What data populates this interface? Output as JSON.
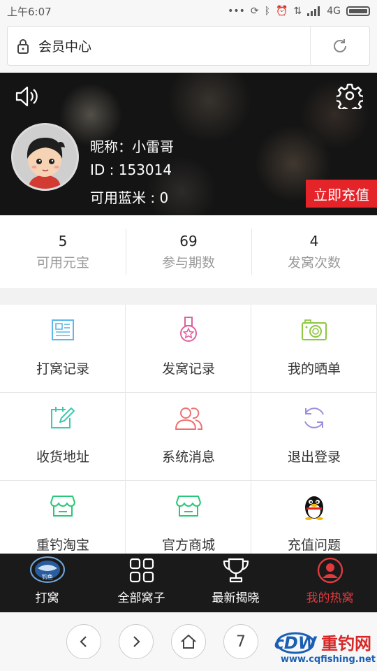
{
  "status_bar": {
    "time": "上午6:07",
    "network": "4G"
  },
  "url_bar": {
    "title": "会员中心"
  },
  "profile": {
    "nickname": "昵称：小雷哥",
    "id": "ID : 153014",
    "blue_rice": "可用蓝米 : 0",
    "recharge_label": "立即充值"
  },
  "stats": [
    {
      "value": "5",
      "label": "可用元宝"
    },
    {
      "value": "69",
      "label": "参与期数"
    },
    {
      "value": "4",
      "label": "发窝次数"
    }
  ],
  "menu": [
    {
      "label": "打窝记录",
      "icon": "document-icon",
      "color": "#5bb8e8"
    },
    {
      "label": "发窝记录",
      "icon": "medal-icon",
      "color": "#e060a0"
    },
    {
      "label": "我的晒单",
      "icon": "camera-icon",
      "color": "#8cc840"
    },
    {
      "label": "收货地址",
      "icon": "edit-calendar-icon",
      "color": "#3cc8b4"
    },
    {
      "label": "系统消息",
      "icon": "users-icon",
      "color": "#ee7070"
    },
    {
      "label": "退出登录",
      "icon": "refresh-icon",
      "color": "#9b8fe0"
    },
    {
      "label": "重钓淘宝",
      "icon": "shop-icon",
      "color": "#28c878"
    },
    {
      "label": "官方商城",
      "icon": "shop-icon",
      "color": "#28c878"
    },
    {
      "label": "充值问题",
      "icon": "qq-penguin-icon",
      "color": "#000000"
    }
  ],
  "bottom_nav": [
    {
      "label": "打窝",
      "icon": "logo-icon"
    },
    {
      "label": "全部窝子",
      "icon": "grid-icon"
    },
    {
      "label": "最新揭晓",
      "icon": "trophy-icon"
    },
    {
      "label": "我的热窝",
      "icon": "user-icon",
      "active": true
    }
  ],
  "browser_controls": {
    "tab_count": "7"
  },
  "watermark": {
    "brand": "重钓网",
    "url": "www.cqfishing.net"
  },
  "colors": {
    "accent_red": "#e5242a",
    "active_nav": "#e03a3e"
  }
}
